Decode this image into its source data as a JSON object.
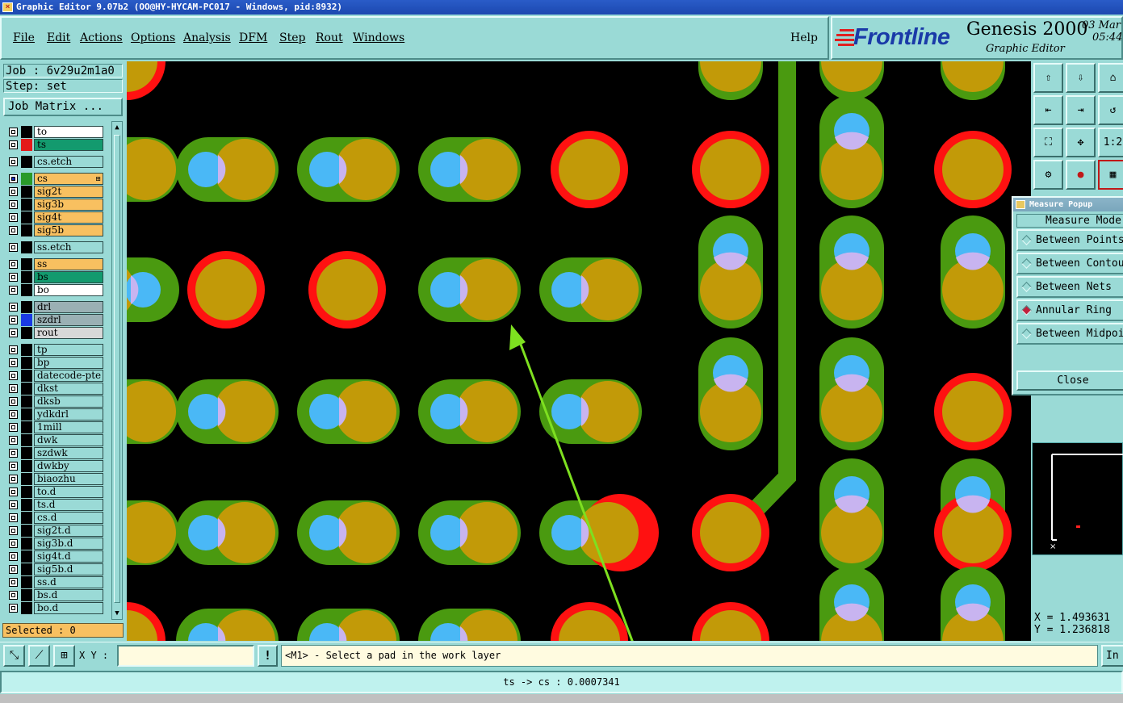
{
  "window": {
    "title": "Graphic Editor 9.07b2  (OO@HY-HYCAM-PC017 - Windows, pid:8932)"
  },
  "menu": [
    "File",
    "Edit",
    "Actions",
    "Options",
    "Analysis",
    "DFM",
    "Step",
    "Rout",
    "Windows"
  ],
  "help_label": "Help",
  "brand": {
    "logo": "Frontline",
    "product": "Genesis 2000",
    "subtitle": "Graphic Editor",
    "date": "03 Mar",
    "time": "05:44"
  },
  "job": {
    "job_line": "Job : 6v29u2m1a0",
    "step_line": "Step: set",
    "matrix_button": "Job Matrix ..."
  },
  "layers": [
    {
      "name": "to",
      "color": "#ffffff",
      "swatch": "#000000",
      "group": 0
    },
    {
      "name": "ts",
      "color": "#139a6e",
      "swatch": "#e41a1a",
      "group": 0
    },
    {
      "name": "cs.etch",
      "color": "#9adad6",
      "swatch": "#000000",
      "group": 1
    },
    {
      "name": "cs",
      "color": "#f8c060",
      "swatch": "#2a9a2a",
      "group": 2,
      "work": true
    },
    {
      "name": "sig2t",
      "color": "#f8c060",
      "swatch": "#000000",
      "group": 2
    },
    {
      "name": "sig3b",
      "color": "#f8c060",
      "swatch": "#000000",
      "group": 2
    },
    {
      "name": "sig4t",
      "color": "#f8c060",
      "swatch": "#000000",
      "group": 2
    },
    {
      "name": "sig5b",
      "color": "#f8c060",
      "swatch": "#000000",
      "group": 2
    },
    {
      "name": "ss.etch",
      "color": "#9adad6",
      "swatch": "#000000",
      "group": 3
    },
    {
      "name": "ss",
      "color": "#f8c060",
      "swatch": "#000000",
      "group": 4
    },
    {
      "name": "bs",
      "color": "#139a6e",
      "swatch": "#000000",
      "group": 4
    },
    {
      "name": "bo",
      "color": "#ffffff",
      "swatch": "#000000",
      "group": 4
    },
    {
      "name": "drl",
      "color": "#9ab0b4",
      "swatch": "#000000",
      "group": 5
    },
    {
      "name": "szdrl",
      "color": "#9ab0b4",
      "swatch": "#1a3ae4",
      "group": 5
    },
    {
      "name": "rout",
      "color": "#d8d8d8",
      "swatch": "#000000",
      "group": 5
    },
    {
      "name": "tp",
      "color": "#9adad6",
      "swatch": "#000000",
      "group": 6
    },
    {
      "name": "bp",
      "color": "#9adad6",
      "swatch": "#000000",
      "group": 6
    },
    {
      "name": "datecode-pte",
      "color": "#9adad6",
      "swatch": "#000000",
      "group": 6
    },
    {
      "name": "dkst",
      "color": "#9adad6",
      "swatch": "#000000",
      "group": 6
    },
    {
      "name": "dksb",
      "color": "#9adad6",
      "swatch": "#000000",
      "group": 6
    },
    {
      "name": "ydkdrl",
      "color": "#9adad6",
      "swatch": "#000000",
      "group": 6
    },
    {
      "name": "1mill",
      "color": "#9adad6",
      "swatch": "#000000",
      "group": 6
    },
    {
      "name": "dwk",
      "color": "#9adad6",
      "swatch": "#000000",
      "group": 6
    },
    {
      "name": "szdwk",
      "color": "#9adad6",
      "swatch": "#000000",
      "group": 6
    },
    {
      "name": "dwkby",
      "color": "#9adad6",
      "swatch": "#000000",
      "group": 6
    },
    {
      "name": "biaozhu",
      "color": "#9adad6",
      "swatch": "#000000",
      "group": 6
    },
    {
      "name": "to.d",
      "color": "#9adad6",
      "swatch": "#000000",
      "group": 6
    },
    {
      "name": "ts.d",
      "color": "#9adad6",
      "swatch": "#000000",
      "group": 6
    },
    {
      "name": "cs.d",
      "color": "#9adad6",
      "swatch": "#000000",
      "group": 6
    },
    {
      "name": "sig2t.d",
      "color": "#9adad6",
      "swatch": "#000000",
      "group": 6
    },
    {
      "name": "sig3b.d",
      "color": "#9adad6",
      "swatch": "#000000",
      "group": 6
    },
    {
      "name": "sig4t.d",
      "color": "#9adad6",
      "swatch": "#000000",
      "group": 6
    },
    {
      "name": "sig5b.d",
      "color": "#9adad6",
      "swatch": "#000000",
      "group": 6
    },
    {
      "name": "ss.d",
      "color": "#9adad6",
      "swatch": "#000000",
      "group": 6
    },
    {
      "name": "bs.d",
      "color": "#9adad6",
      "swatch": "#000000",
      "group": 6
    },
    {
      "name": "bo.d",
      "color": "#9adad6",
      "swatch": "#000000",
      "group": 6
    }
  ],
  "selected": "Selected : 0",
  "measure_popup": {
    "title": "Measure Popup",
    "mode_label": "Measure Mode",
    "options": [
      {
        "label": "Between Points",
        "selected": false
      },
      {
        "label": "Between Contours",
        "selected": false
      },
      {
        "label": "Between Nets",
        "selected": false
      },
      {
        "label": "Annular Ring",
        "selected": true
      },
      {
        "label": "Between Midpoints",
        "selected": false
      }
    ],
    "close_label": "Close"
  },
  "right_toolbar": {
    "icons": [
      "import-icon",
      "export-icon",
      "home-icon",
      "step-in-icon",
      "step-out-icon",
      "rotate-icon",
      "zoom-fit-icon",
      "zoom-center-icon",
      "scale-1-2-icon",
      "tools-icon",
      "measure-icon",
      "grid-icon"
    ],
    "ratio_label": "1:2"
  },
  "coords": {
    "x": "X = 1.493631",
    "y": "Y = 1.236818"
  },
  "input": {
    "xy_label": "X Y :",
    "xy_value": "",
    "bang": "!",
    "prompt": "<M1> - Select a pad in the work layer",
    "in_label": "In"
  },
  "status": "ts -> cs : 0.0007341",
  "colors": {
    "ring_red": "#ff1111",
    "mask_green": "#4a9a10",
    "pad_gold": "#c29a08",
    "drill_blue": "#4ab8f6",
    "overlap_lavender": "#c8b4f0",
    "arrow": "#7ee020",
    "background": "#9adad6"
  }
}
